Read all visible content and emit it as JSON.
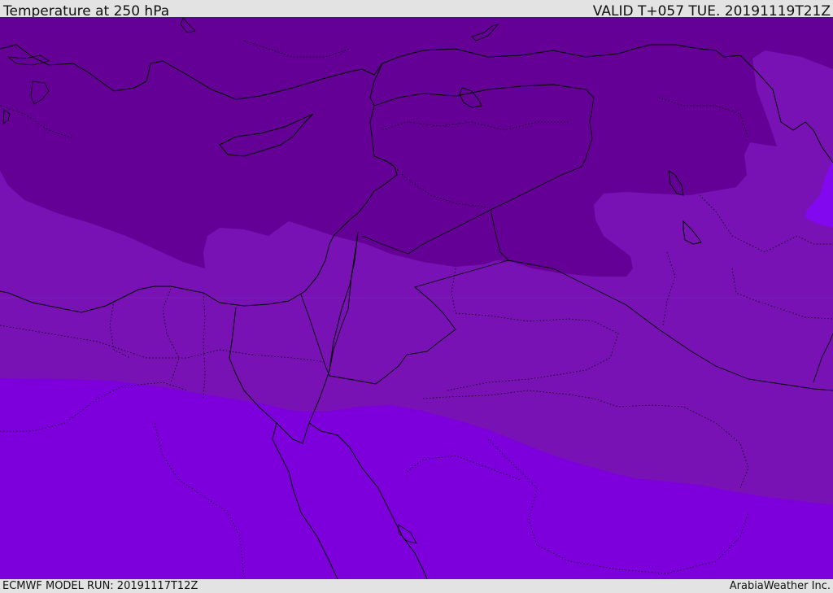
{
  "header": {
    "title": "Temperature at 250 hPa",
    "valid": "VALID T+057 TUE. 20191119T21Z"
  },
  "footer": {
    "model_run": "ECMWF MODEL RUN: 20191117T12Z",
    "credit": "ArabiaWeather Inc."
  },
  "map": {
    "colors": {
      "cold_band": "#640096",
      "mid_band": "#7812b4",
      "warm_band": "#7d00dc",
      "edge_band": "#8208f0",
      "border": "#000000"
    }
  }
}
